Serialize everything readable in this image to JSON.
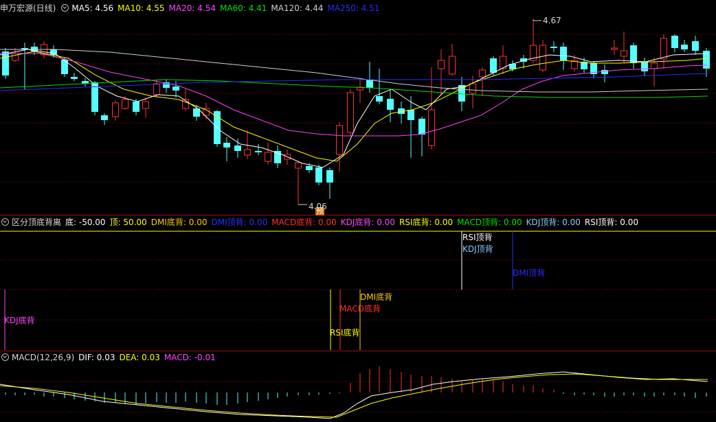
{
  "main_legend": {
    "title": "申万宏源(日线)",
    "items": [
      {
        "text": "MA5: 4.56",
        "color": "#ffffff"
      },
      {
        "text": "MA10: 4.55",
        "color": "#ffff00"
      },
      {
        "text": "MA20: 4.54",
        "color": "#ff44ff"
      },
      {
        "text": "MA60: 4.41",
        "color": "#00e000"
      },
      {
        "text": "MA120: 4.44",
        "color": "#d0d0d0"
      },
      {
        "text": "MA250: 4.51",
        "color": "#2b2bff"
      }
    ]
  },
  "price_annotations": {
    "high": "4.67",
    "low": "4.06",
    "badge": "预"
  },
  "div_legend": {
    "title": "区分顶底背离",
    "items": [
      {
        "text": "底: -50.00",
        "color": "#ffffff"
      },
      {
        "text": "顶: 50.00",
        "color": "#ffff00"
      },
      {
        "text": "DMI底背: 0.00",
        "color": "#ffcc00"
      },
      {
        "text": "DMI顶背: 0.00",
        "color": "#2b2bff"
      },
      {
        "text": "MACD底背: 0.00",
        "color": "#ff3030"
      },
      {
        "text": "KDJ底背: 0.00",
        "color": "#ff44ff"
      },
      {
        "text": "RSI底背: 0.00",
        "color": "#ffff00"
      },
      {
        "text": "MACD顶背: 0.00",
        "color": "#00e000"
      },
      {
        "text": "KDJ顶背: 0.00",
        "color": "#88ccff"
      },
      {
        "text": "RSI顶背: 0.00",
        "color": "#ffffff"
      }
    ]
  },
  "signals": {
    "rsi_top": "RSI顶背",
    "kdj_top": "KDJ顶背",
    "dmi_top": "DMI顶背",
    "kdj_bottom": "KDJ底背",
    "rsi_bottom": "RSI底背",
    "macd_bottom": "MACD底背",
    "dmi_bottom": "DMI底背"
  },
  "macd_legend": {
    "title": "MACD(12,26,9)",
    "items": [
      {
        "text": "DIF: 0.03",
        "color": "#ffffff"
      },
      {
        "text": "DEA: 0.03",
        "color": "#ffff00"
      },
      {
        "text": "MACD: -0.01",
        "color": "#ff44ff"
      }
    ]
  },
  "colors": {
    "up": "#ff3232",
    "down": "#54ffff",
    "grid": "#9b1010"
  }
}
